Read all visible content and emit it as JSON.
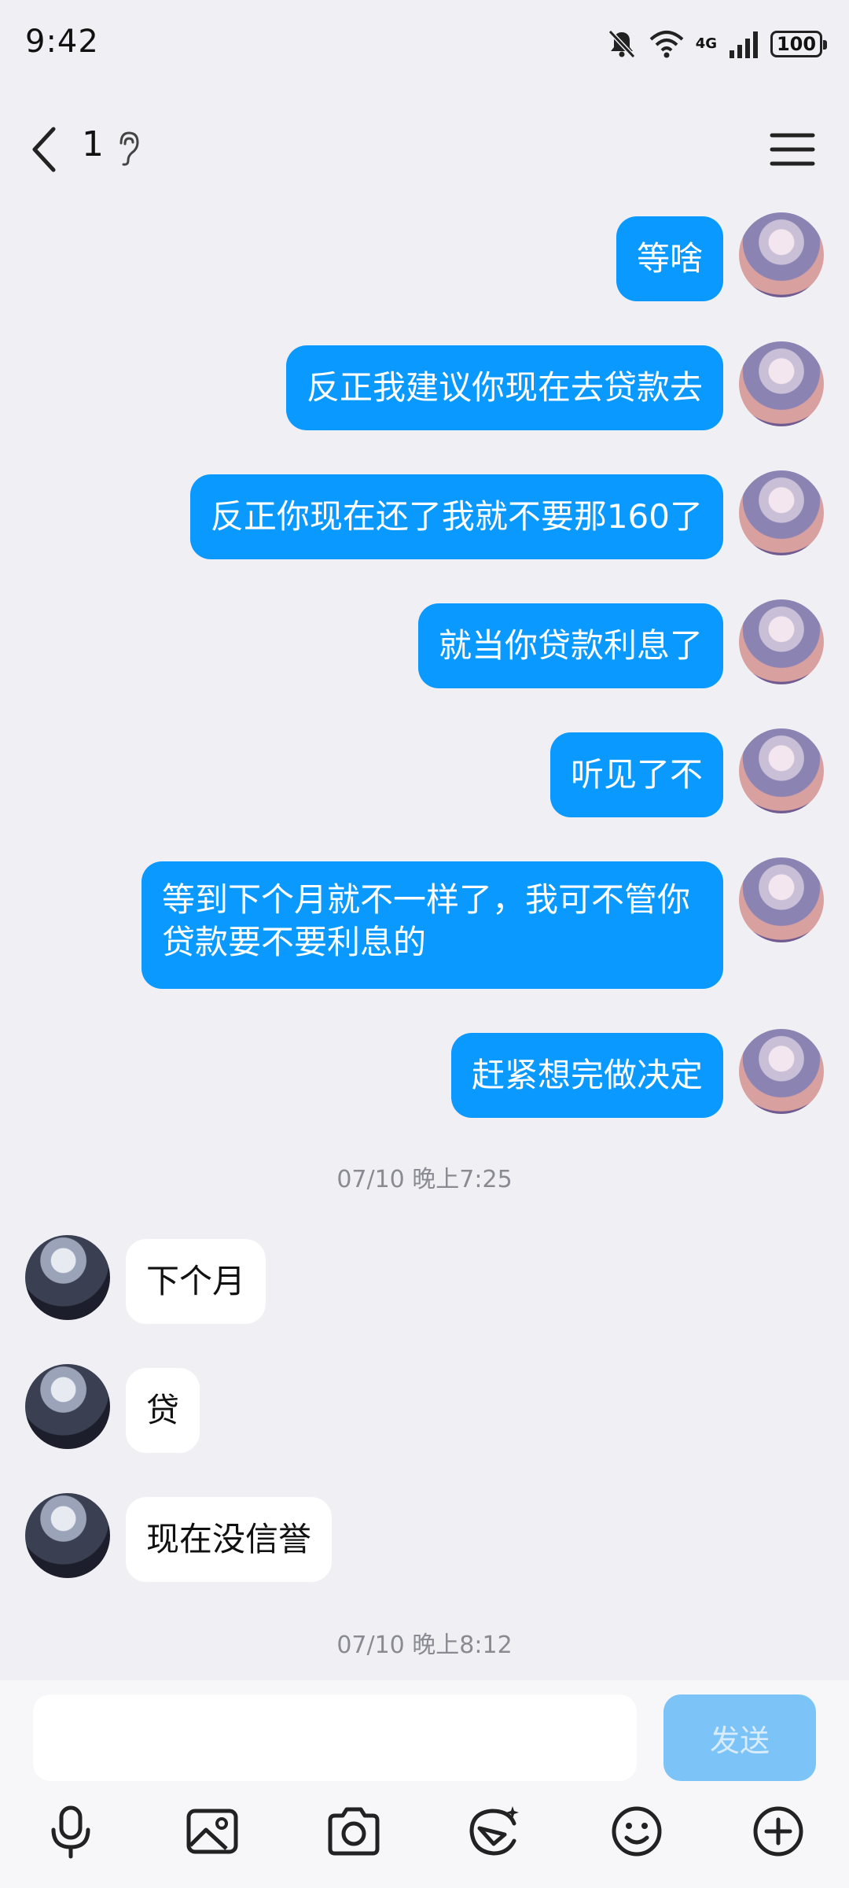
{
  "status_bar": {
    "time": "9:42",
    "network": "4G",
    "battery": "100"
  },
  "header": {
    "title": "1"
  },
  "messages_me": [
    "等啥",
    "反正我建议你现在去贷款去",
    "反正你现在还了我就不要那160了",
    "就当你贷款利息了",
    "听见了不",
    "等到下个月就不一样了，我可不管你贷款要不要利息的",
    "赶紧想完做决定"
  ],
  "timestamps": [
    "07/10 晚上7:25",
    "07/10 晚上8:12"
  ],
  "messages_other": [
    "下个月",
    "贷",
    "现在没信誉"
  ],
  "composer": {
    "input_value": "",
    "send_label": "发送"
  },
  "colors": {
    "my_bubble": "#0a99ff",
    "other_bubble": "#ffffff",
    "background": "#f0f0f4"
  },
  "icons": [
    "mute-icon",
    "wifi-icon",
    "signal-icon",
    "battery-icon",
    "back-icon",
    "ear-icon",
    "menu-icon",
    "mic-icon",
    "image-icon",
    "camera-icon",
    "sticker-icon",
    "emoji-icon",
    "plus-icon"
  ]
}
